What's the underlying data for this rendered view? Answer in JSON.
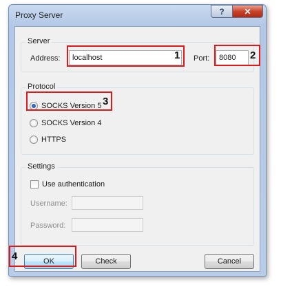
{
  "window": {
    "title": "Proxy Server",
    "help_glyph": "?",
    "close_glyph": "✕"
  },
  "server": {
    "legend": "Server",
    "address_label": "Address:",
    "address_value": "localhost",
    "port_label": "Port:",
    "port_value": "8080"
  },
  "protocol": {
    "legend": "Protocol",
    "options": [
      {
        "label": "SOCKS Version 5",
        "selected": true
      },
      {
        "label": "SOCKS Version 4",
        "selected": false
      },
      {
        "label": "HTTPS",
        "selected": false
      }
    ]
  },
  "settings": {
    "legend": "Settings",
    "use_auth_label": "Use authentication",
    "use_auth_checked": false,
    "username_label": "Username:",
    "username_value": "",
    "password_label": "Password:",
    "password_value": ""
  },
  "buttons": {
    "ok": "OK",
    "check": "Check",
    "cancel": "Cancel"
  },
  "annotations": {
    "marker_1": "1",
    "marker_2": "2",
    "marker_3": "3",
    "marker_4": "4",
    "highlight_color": "#e01818"
  }
}
